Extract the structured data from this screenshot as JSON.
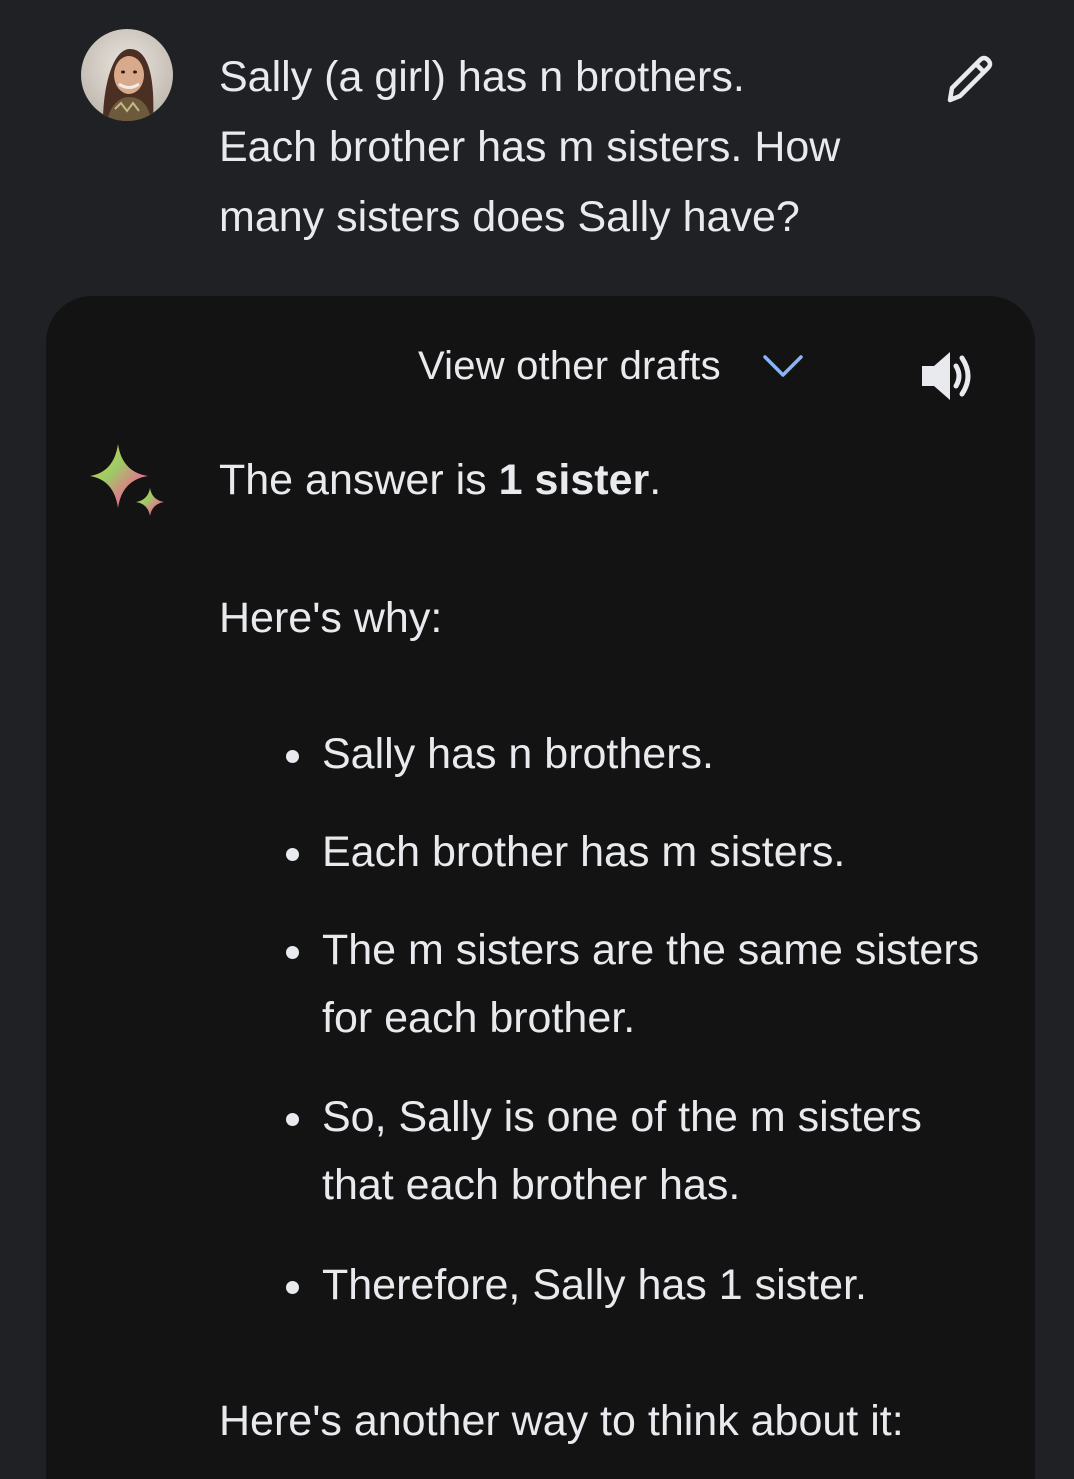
{
  "user": {
    "prompt_line1": "Sally (a girl) has n brothers.",
    "prompt_line2": "Each brother has m sisters. How",
    "prompt_line3": "many sisters does Sally have?",
    "avatar_icon": "user-avatar-photo",
    "edit_icon": "pencil-icon"
  },
  "response": {
    "drafts_label": "View other drafts",
    "drafts_icon": "chevron-down-icon",
    "speaker_icon": "speaker-icon",
    "sparkle_icon": "gemini-sparkle-icon",
    "answer_prefix": "The answer is ",
    "answer_bold": "1 sister",
    "answer_suffix": ".",
    "why_heading": "Here's why:",
    "bullets": [
      "Sally has n brothers.",
      "Each brother has m sisters.",
      "The m sisters are the same sisters for each brother.",
      "So, Sally is one of the m sisters that each brother has.",
      "Therefore, Sally has 1 sister."
    ],
    "another_heading": "Here's another way to think about it:"
  },
  "colors": {
    "background": "#202124",
    "card": "#131314",
    "text": "#e8eaed",
    "accent_chevron": "#8ab4f8"
  }
}
